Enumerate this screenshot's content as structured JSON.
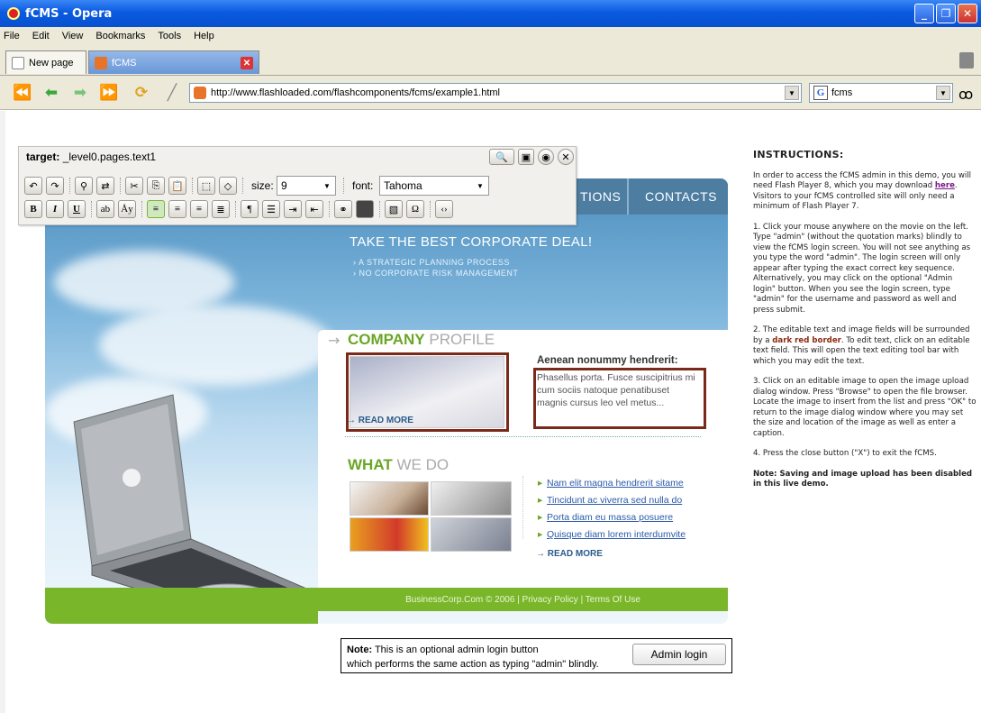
{
  "window": {
    "title": "fCMS - Opera",
    "minimize": "_",
    "maximize": "❐",
    "close": "✕"
  },
  "menu": [
    "File",
    "Edit",
    "View",
    "Bookmarks",
    "Tools",
    "Help"
  ],
  "tabs": [
    {
      "label": "New page",
      "icon": "page-icon"
    },
    {
      "label": "fCMS",
      "icon": "rss-icon",
      "active": true
    }
  ],
  "nav": {
    "url": "http://www.flashloaded.com/flashcomponents/fcms/example1.html",
    "search_engine": "G",
    "search_value": "fcms"
  },
  "editor": {
    "target_label": "target:",
    "target_value": "_level0.pages.text1",
    "size_label": "size:",
    "size_value": "9",
    "font_label": "font:",
    "font_value": "Tahoma"
  },
  "site": {
    "nav_items": [
      "TIONS",
      "CONTACTS"
    ],
    "deal": "TAKE THE BEST CORPORATE DEAL!",
    "bullets": [
      "› A STRATEGIC PLANNING PROCESS",
      "› NO CORPORATE RISK MANAGEMENT"
    ],
    "company_a": "COMPANY",
    "company_b": " PROFILE",
    "aenean": "Aenean nonummy hendrerit:",
    "para": "Phasellus porta. Fusce suscipitrius mi cum sociis natoque penatibuset magnis cursus leo vel metus...",
    "read_more": "→ READ MORE",
    "whatwedo_a": "WHAT",
    "whatwedo_b": " WE DO",
    "links": [
      "Nam elit magna hendrerit sitame",
      "Tincidunt ac viverra sed nulla do",
      "Porta diam eu massa posuere",
      "Quisque diam lorem interdumvite"
    ],
    "footer": "BusinessCorp.Com © 2006 | Privacy Policy | Terms Of Use"
  },
  "note": {
    "label": "Note:",
    "text1": " This is an optional admin login button",
    "text2": "which performs the same action as typing \"admin\" blindly.",
    "button": "Admin login"
  },
  "instructions": {
    "title": "INSTRUCTIONS:",
    "p1a": "In order to access the fCMS admin in this demo, you will need Flash Player 8, which you may download ",
    "p1link": "here",
    "p1b": ". Visitors to your fCMS controlled site will only need a minimum of Flash Player 7.",
    "p2": "1. Click your mouse anywhere on the movie on the left. Type \"admin\" (without the quotation marks) blindly to view the fCMS login screen. You will not see anything as you type the word \"admin\". The login screen will only appear after typing the exact correct key sequence. Alternatively, you may click on the optional \"Admin login\" button. When you see the login screen, type \"admin\" for the username and password as well and press submit.",
    "p3a": "2. The editable text and image fields will be surrounded by a ",
    "p3b": "dark red border",
    "p3c": ". To edit text, click on an editable text field. This will open the text editing tool bar with which you may edit the text.",
    "p4": "3. Click on an editable image to open the image upload dialog window. Press \"Browse\" to open the file browser. Locate the image to insert from the list and press \"OK\" to return to the image dialog window where you may set the size and location of the image as well as enter a caption.",
    "p5": "4. Press the close button (\"X\") to exit the fCMS.",
    "p6": "Note: Saving and image upload has been disabled in this live demo."
  },
  "colors": {
    "accent_green": "#7ab62a",
    "border_red": "#7a2a1a",
    "title_blue": "#0a5ae0"
  }
}
